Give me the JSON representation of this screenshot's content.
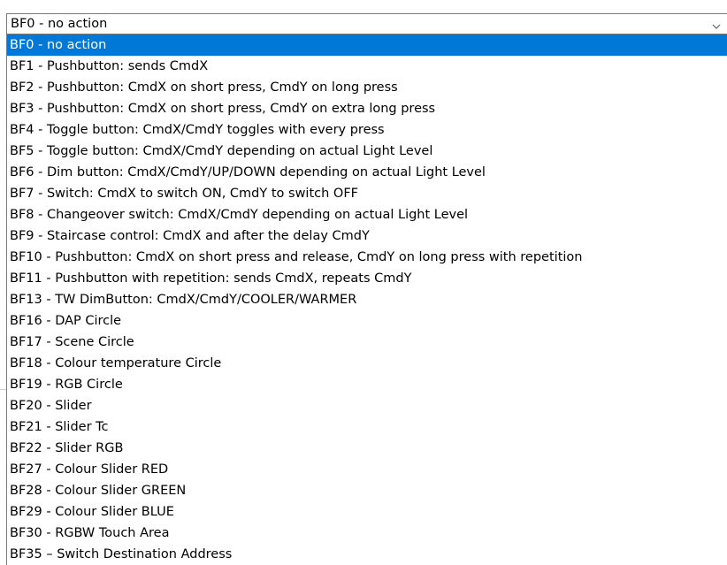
{
  "combobox": {
    "selected_value": "BF0 - no action",
    "options": [
      "BF0 - no action",
      "BF1 - Pushbutton:  sends CmdX",
      "BF2 - Pushbutton:  CmdX on short press, CmdY on long press",
      "BF3 - Pushbutton:  CmdX on short press, CmdY on extra long press",
      "BF4 - Toggle button:  CmdX/CmdY toggles with every press",
      "BF5 - Toggle button:  CmdX/CmdY depending on actual Light Level",
      "BF6 - Dim button:  CmdX/CmdY/UP/DOWN depending on actual Light Level",
      "BF7 - Switch:  CmdX to switch ON, CmdY to switch OFF",
      "BF8 - Changeover switch:  CmdX/CmdY depending on actual Light Level",
      "BF9 - Staircase control:  CmdX and after the delay CmdY",
      "BF10 - Pushbutton:  CmdX on short press and release, CmdY on long press with repetition",
      "BF11 - Pushbutton with repetition: sends CmdX, repeats CmdY",
      "BF13 - TW DimButton:  CmdX/CmdY/COOLER/WARMER",
      "BF16 - DAP Circle",
      "BF17 - Scene Circle",
      "BF18 - Colour temperature Circle",
      "BF19 - RGB Circle",
      "BF20 - Slider",
      "BF21 - Slider Tc",
      "BF22 - Slider RGB",
      "BF27 - Colour Slider RED",
      "BF28 - Colour Slider GREEN",
      "BF29 - Colour Slider BLUE",
      "BF30 - RGBW Touch Area",
      "BF35 – Switch Destination Address"
    ],
    "highlighted_index": 0,
    "chevron_icon": "chevron-down-icon"
  },
  "colors": {
    "highlight": "#0078d7",
    "border": "#7a7a7a"
  }
}
